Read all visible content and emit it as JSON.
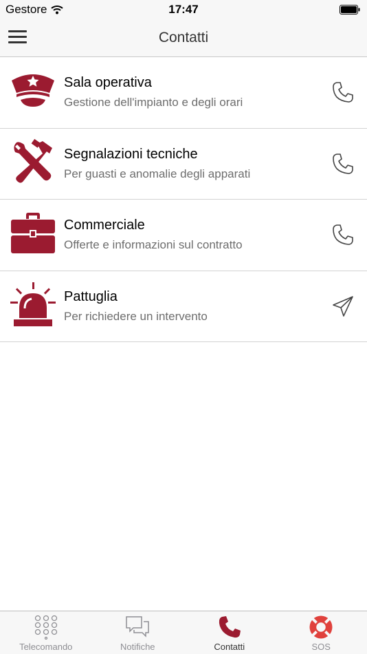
{
  "status_bar": {
    "carrier": "Gestore",
    "time": "17:47"
  },
  "header": {
    "title": "Contatti"
  },
  "contacts": [
    {
      "title": "Sala operativa",
      "subtitle": "Gestione dell'impianto e degli orari",
      "icon": "police-cap-icon",
      "action_icon": "phone-icon"
    },
    {
      "title": "Segnalazioni tecniche",
      "subtitle": "Per guasti e anomalie degli apparati",
      "icon": "tools-icon",
      "action_icon": "phone-icon"
    },
    {
      "title": "Commerciale",
      "subtitle": "Offerte e informazioni sul contratto",
      "icon": "briefcase-icon",
      "action_icon": "phone-icon"
    },
    {
      "title": "Pattuglia",
      "subtitle": "Per richiedere un intervento",
      "icon": "alarm-siren-icon",
      "action_icon": "send-icon"
    }
  ],
  "tabs": [
    {
      "label": "Telecomando",
      "icon": "keypad-icon",
      "active": false
    },
    {
      "label": "Notifiche",
      "icon": "chat-bubbles-icon",
      "active": false
    },
    {
      "label": "Contatti",
      "icon": "phone-icon",
      "active": true
    },
    {
      "label": "SOS",
      "icon": "lifebuoy-icon",
      "active": false
    }
  ],
  "colors": {
    "accent": "#9b1b30",
    "sos": "#e0413c",
    "inactive": "#8e8e93",
    "bar_bg": "#f7f7f7"
  }
}
